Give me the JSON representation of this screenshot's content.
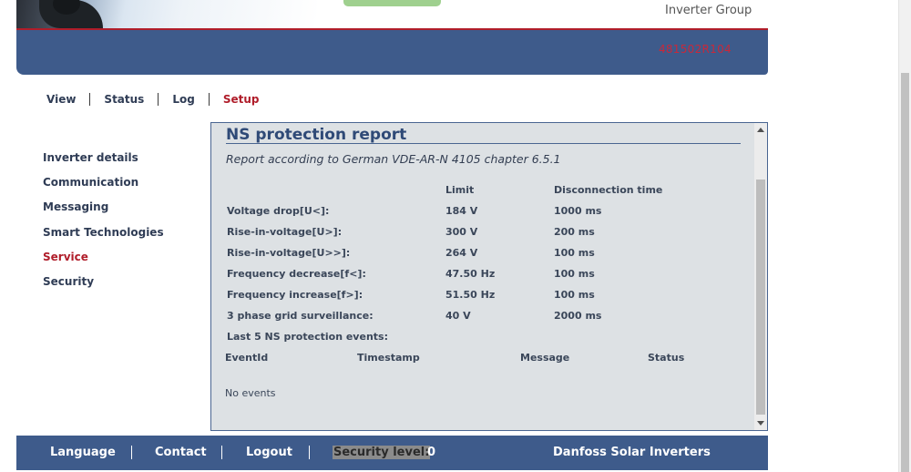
{
  "header": {
    "group_label": "Inverter Group",
    "serial": "481502R104"
  },
  "top_nav": [
    "View",
    "Status",
    "Log",
    "Setup"
  ],
  "side_nav": [
    "Inverter details",
    "Communication",
    "Messaging",
    "Smart Technologies",
    "Service",
    "Security"
  ],
  "panel": {
    "title": "NS protection report",
    "subtitle": "Report according to German VDE-AR-N 4105 chapter 6.5.1",
    "headers": {
      "limit": "Limit",
      "disconnection_time": "Disconnection time"
    },
    "rows": [
      {
        "label": "Voltage drop[U<]:",
        "limit": "184 V",
        "time": "1000 ms"
      },
      {
        "label": "Rise-in-voltage[U>]:",
        "limit": "300 V",
        "time": "200 ms"
      },
      {
        "label": "Rise-in-voltage[U>>]:",
        "limit": "264 V",
        "time": "100 ms"
      },
      {
        "label": "Frequency decrease[f<]:",
        "limit": "47.50 Hz",
        "time": "100 ms"
      },
      {
        "label": "Frequency increase[f>]:",
        "limit": "51.50 Hz",
        "time": "100 ms"
      },
      {
        "label": "3 phase grid surveillance:",
        "limit": "40 V",
        "time": "2000 ms"
      }
    ],
    "events_heading": "Last 5 NS protection events:",
    "event_columns": {
      "id": "EventId",
      "timestamp": "Timestamp",
      "message": "Message",
      "status": "Status"
    },
    "no_events": "No events"
  },
  "footer": {
    "language": "Language",
    "contact": "Contact",
    "logout": "Logout",
    "security_label": "Security level:",
    "security_value": "0",
    "brand": "Danfoss Solar Inverters"
  },
  "colors": {
    "accent_blue": "#3e5b8b",
    "active_red": "#b01d2a",
    "panel_bg": "#dde1e4"
  }
}
